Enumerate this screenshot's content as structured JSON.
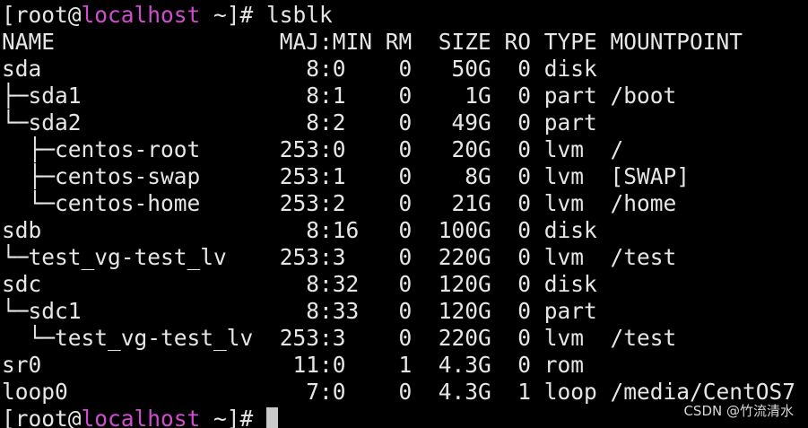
{
  "prompt_top": {
    "open": "[root@",
    "host": "localhost",
    "close": " ~]# ",
    "command": "lsblk"
  },
  "header": "NAME                 MAJ:MIN RM  SIZE RO TYPE MOUNTPOINT",
  "rows": [
    "sda                    8:0    0   50G  0 disk ",
    "├─sda1                 8:1    0    1G  0 part /boot",
    "└─sda2                 8:2    0   49G  0 part ",
    "  ├─centos-root      253:0    0   20G  0 lvm  /",
    "  ├─centos-swap      253:1    0    8G  0 lvm  [SWAP]",
    "  └─centos-home      253:2    0   21G  0 lvm  /home",
    "sdb                    8:16   0  100G  0 disk ",
    "└─test_vg-test_lv    253:3    0  220G  0 lvm  /test",
    "sdc                    8:32   0  120G  0 disk ",
    "└─sdc1                 8:33   0  120G  0 part ",
    "  └─test_vg-test_lv  253:3    0  220G  0 lvm  /test",
    "sr0                   11:0    1  4.3G  0 rom  ",
    "loop0                  7:0    0  4.3G  1 loop /media/CentOS7"
  ],
  "prompt_bottom": {
    "open": "[root@",
    "host": "localhost",
    "close": " ~]# "
  },
  "watermark": "CSDN @竹流清水",
  "colors": {
    "background": "#000000",
    "text": "#e6e6e6",
    "hostname": "#d04dd0",
    "cursor": "#c9c9c9"
  }
}
